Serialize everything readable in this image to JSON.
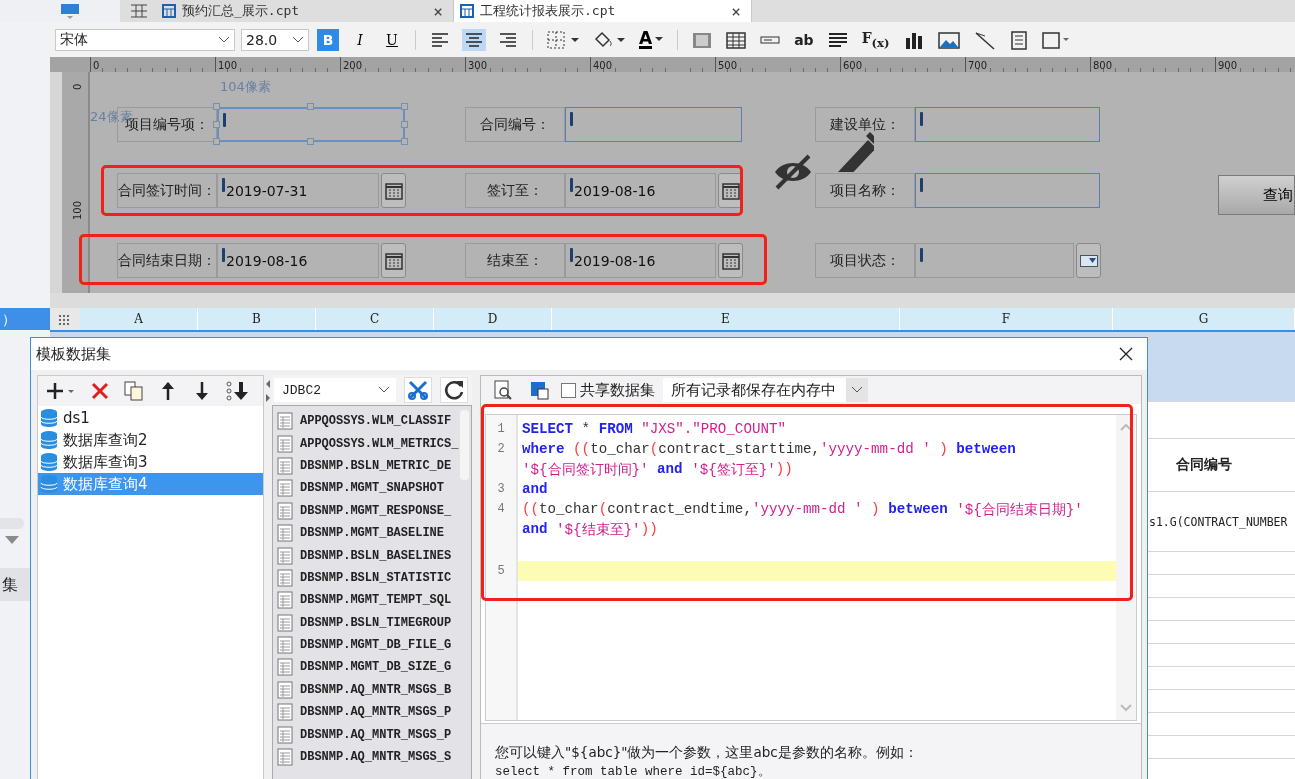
{
  "tabs": [
    {
      "label": "预约汇总_展示.cpt",
      "close": "×",
      "selected": false
    },
    {
      "label": "工程统计报表展示.cpt",
      "close": "×",
      "selected": true
    }
  ],
  "toolbar": {
    "font": "宋体",
    "size": "28.0",
    "format_buttons": [
      {
        "label": "B",
        "kind": "bold",
        "selected": true
      },
      {
        "label": "I",
        "kind": "italic",
        "selected": false
      },
      {
        "label": "U",
        "kind": "underline",
        "selected": false
      }
    ],
    "align_buttons": [
      {
        "kind": "left",
        "selected": false
      },
      {
        "kind": "center",
        "selected": true
      },
      {
        "kind": "right",
        "selected": false
      }
    ],
    "font_color_label": "A",
    "text_widget_label": "ab",
    "formula_label": "F$_{(x)}$"
  },
  "ruler": {
    "horizontal": [
      "0",
      "100",
      "200",
      "300",
      "400",
      "500",
      "600",
      "700",
      "800",
      "900"
    ],
    "vertical": [
      "0",
      "100"
    ]
  },
  "form": {
    "size_hints": [
      "104像素",
      "24像素"
    ],
    "rows": [
      [
        {
          "label": "项目编号项：",
          "kind": "text",
          "selected": true
        },
        {
          "label": "合同编号：",
          "kind": "text",
          "selected": false
        },
        {
          "label": "建设单位：",
          "kind": "text",
          "selected": false
        }
      ],
      [
        {
          "label": "合同签订时间：",
          "kind": "date",
          "value": "2019-07-31",
          "selected": false
        },
        {
          "label": "签订至：",
          "kind": "date",
          "value": "2019-08-16",
          "selected": false
        },
        {
          "label": "项目名称：",
          "kind": "text",
          "selected": false
        }
      ],
      [
        {
          "label": "合同结束日期：",
          "kind": "date",
          "value": "2019-08-16",
          "selected": false
        },
        {
          "label": "结束至：",
          "kind": "date",
          "value": "2019-08-16",
          "selected": false
        },
        {
          "label": "项目状态：",
          "kind": "combo",
          "selected": false
        }
      ]
    ],
    "query_button": "查询"
  },
  "left_strip": [
    {
      "label": "）",
      "selected": true
    },
    {
      "label": "集",
      "selected": false
    }
  ],
  "sheet": {
    "columns": [
      "A",
      "B",
      "C",
      "D",
      "E",
      "F",
      "G"
    ],
    "cells": [
      "合同编号",
      "s1.G(CONTRACT_NUMBER"
    ]
  },
  "dialog": {
    "title": "模板数据集",
    "datasets": [
      {
        "name": "ds1",
        "selected": false
      },
      {
        "name": "数据库查询2",
        "selected": false
      },
      {
        "name": "数据库查询3",
        "selected": false
      },
      {
        "name": "数据库查询4",
        "selected": true
      }
    ],
    "connection": "JDBC2",
    "tables": [
      "APPQOSSYS.WLM_CLASSIF",
      "APPQOSSYS.WLM_METRICS_",
      "DBSNMP.BSLN_METRIC_DE",
      "DBSNMP.MGMT_SNAPSHOT",
      "DBSNMP.MGMT_RESPONSE_",
      "DBSNMP.MGMT_BASELINE",
      "DBSNMP.BSLN_BASELINES",
      "DBSNMP.BSLN_STATISTIC",
      "DBSNMP.MGMT_TEMPT_SQL",
      "DBSNMP.BSLN_TIMEGROUP",
      "DBSNMP.MGMT_DB_FILE_G",
      "DBSNMP.MGMT_DB_SIZE_G",
      "DBSNMP.AQ_MNTR_MSGS_B",
      "DBSNMP.AQ_MNTR_MSGS_P",
      "DBSNMP.AQ_MNTR_MSGS_P",
      "DBSNMP.AQ_MNTR_MSGS_S"
    ],
    "share_checkbox": {
      "label": "共享数据集",
      "checked": false
    },
    "cache_mode": "所有记录都保存在内存中",
    "sql": [
      {
        "number": "1",
        "current": false,
        "wrapped_lines": [
          [
            {
              "kind": "keyword",
              "text": "SELECT"
            },
            {
              "kind": "plain",
              "text": " * "
            },
            {
              "kind": "keyword",
              "text": "FROM"
            },
            {
              "kind": "string",
              "text": " \"JXS\".\"PRO_COUNT\""
            }
          ]
        ]
      },
      {
        "number": "2",
        "current": false,
        "wrapped_lines": [
          [
            {
              "kind": "keyword",
              "text": "where"
            },
            {
              "kind": "paren",
              "text": " (("
            },
            {
              "kind": "plain",
              "text": "to_char"
            },
            {
              "kind": "paren",
              "text": "("
            },
            {
              "kind": "plain",
              "text": "contract_starttime,"
            },
            {
              "kind": "string",
              "text": "'yyyy-mm-dd '"
            },
            {
              "kind": "paren",
              "text": " )"
            },
            {
              "kind": "keyword",
              "text": " between"
            }
          ],
          [
            {
              "kind": "string",
              "text": "'${合同签订时间}'"
            },
            {
              "kind": "keyword",
              "text": " and "
            },
            {
              "kind": "string",
              "text": "'${签订至}'"
            },
            {
              "kind": "paren",
              "text": "))"
            }
          ]
        ]
      },
      {
        "number": "3",
        "current": false,
        "wrapped_lines": [
          [
            {
              "kind": "keyword",
              "text": "and"
            }
          ]
        ]
      },
      {
        "number": "4",
        "current": false,
        "wrapped_lines": [
          [
            {
              "kind": "paren",
              "text": "(("
            },
            {
              "kind": "plain",
              "text": "to_char"
            },
            {
              "kind": "paren",
              "text": "("
            },
            {
              "kind": "plain",
              "text": "contract_endtime,"
            },
            {
              "kind": "string",
              "text": "'yyyy-mm-dd '"
            },
            {
              "kind": "paren",
              "text": " )"
            },
            {
              "kind": "keyword",
              "text": " between "
            },
            {
              "kind": "string",
              "text": "'${合同结束日期}'"
            }
          ],
          [
            {
              "kind": "keyword",
              "text": "and "
            },
            {
              "kind": "string",
              "text": "'${结束至}'"
            },
            {
              "kind": "paren",
              "text": "))"
            }
          ]
        ]
      },
      {
        "number": "5",
        "current": true
      }
    ],
    "help": [
      "您可以键入\"${abc}\"做为一个参数，这里abc是参数的名称。例如：",
      "select * from table where id=${abc}。"
    ]
  }
}
